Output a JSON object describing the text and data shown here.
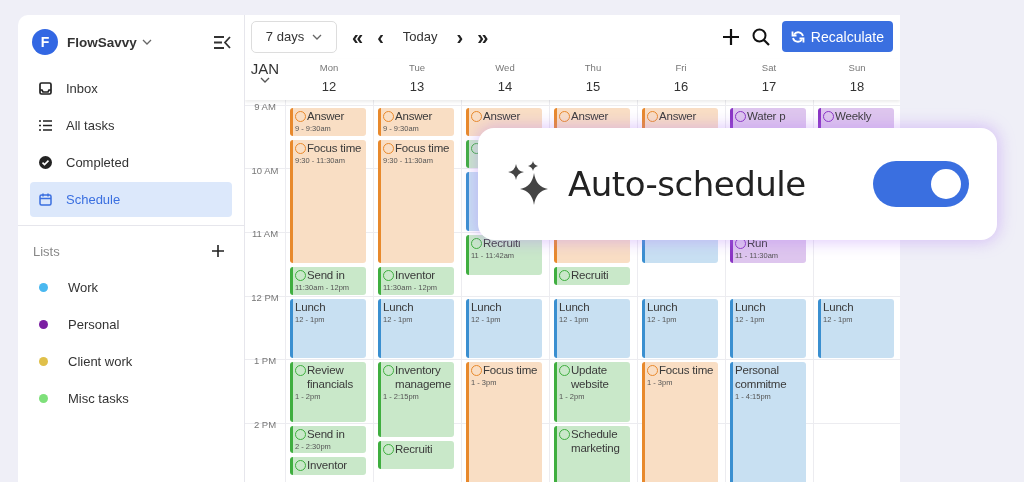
{
  "sidebar": {
    "workspace": {
      "initial": "F",
      "name": "FlowSavvy"
    },
    "nav": [
      {
        "label": "Inbox",
        "selected": false
      },
      {
        "label": "All tasks",
        "selected": false
      },
      {
        "label": "Completed",
        "selected": false
      },
      {
        "label": "Schedule",
        "selected": true
      }
    ],
    "lists_title": "Lists",
    "lists": [
      {
        "label": "Work",
        "color": "#4ab8f0"
      },
      {
        "label": "Personal",
        "color": "#7b1fa2"
      },
      {
        "label": "Client work",
        "color": "#e0c04a"
      },
      {
        "label": "Misc tasks",
        "color": "#7ee07a"
      }
    ]
  },
  "toolbar": {
    "range": "7 days",
    "first": "«",
    "prev": "‹",
    "today": "Today",
    "next": "›",
    "last": "»",
    "recalculate": "Recalculate"
  },
  "calendar": {
    "month": "JAN",
    "hours": [
      "9 AM",
      "10 AM",
      "11 AM",
      "12 PM",
      "1 PM",
      "2 PM"
    ],
    "days": [
      {
        "name": "Mon",
        "date": "12",
        "events": [
          {
            "kind": "task",
            "title": "Answer",
            "time": "9 - 9:30am",
            "color": "#e8892c"
          },
          {
            "kind": "task",
            "title": "Focus time",
            "time": "9:30 - 11:30am",
            "color": "#e8892c"
          },
          {
            "kind": "task",
            "title": "Send in",
            "time": "11:30am - 12pm",
            "color": "#3fae3f"
          },
          {
            "kind": "event",
            "title": "Lunch",
            "time": "12 - 1pm",
            "color": "#3a8fd0"
          },
          {
            "kind": "task",
            "title": "Review financials",
            "time": "1 - 2pm",
            "color": "#3fae3f"
          },
          {
            "kind": "task",
            "title": "Send in",
            "time": "2 - 2:30pm",
            "color": "#3fae3f"
          },
          {
            "kind": "task",
            "title": "Inventor",
            "color": "#3fae3f"
          }
        ]
      },
      {
        "name": "Tue",
        "date": "13",
        "events": [
          {
            "kind": "task",
            "title": "Answer",
            "time": "9 - 9:30am",
            "color": "#e8892c"
          },
          {
            "kind": "task",
            "title": "Focus time",
            "time": "9:30 - 11:30am",
            "color": "#e8892c"
          },
          {
            "kind": "task",
            "title": "Inventor",
            "time": "11:30am - 12pm",
            "color": "#3fae3f"
          },
          {
            "kind": "event",
            "title": "Lunch",
            "time": "12 - 1pm",
            "color": "#3a8fd0"
          },
          {
            "kind": "task",
            "title": "Inventory manageme",
            "time": "1 - 2:15pm",
            "color": "#3fae3f"
          },
          {
            "kind": "task",
            "title": "Recruiti",
            "color": "#3fae3f"
          }
        ]
      },
      {
        "name": "Wed",
        "date": "14",
        "events": [
          {
            "kind": "task",
            "title": "Answer",
            "color": "#e8892c"
          },
          {
            "kind": "task",
            "color": "#3fae3f"
          },
          {
            "kind": "event",
            "color": "#3a8fd0"
          },
          {
            "kind": "task",
            "title": "Recruiti",
            "time": "11 - 11:42am",
            "color": "#3fae3f"
          },
          {
            "kind": "event",
            "title": "Lunch",
            "time": "12 - 1pm",
            "color": "#3a8fd0"
          },
          {
            "kind": "task",
            "title": "Focus time",
            "time": "1 - 3pm",
            "color": "#e8892c"
          }
        ]
      },
      {
        "name": "Thu",
        "date": "15",
        "events": [
          {
            "kind": "task",
            "title": "Answer",
            "color": "#e8892c"
          },
          {
            "kind": "event",
            "color": "#e8892c"
          },
          {
            "kind": "task",
            "title": "Recruiti",
            "color": "#3fae3f"
          },
          {
            "kind": "event",
            "title": "Lunch",
            "time": "12 - 1pm",
            "color": "#3a8fd0"
          },
          {
            "kind": "task",
            "title": "Update website",
            "time": "1 - 2pm",
            "color": "#3fae3f"
          },
          {
            "kind": "task",
            "title": "Schedule marketing",
            "color": "#3fae3f"
          }
        ]
      },
      {
        "name": "Fri",
        "date": "16",
        "events": [
          {
            "kind": "task",
            "title": "Answer",
            "color": "#e8892c"
          },
          {
            "kind": "event",
            "color": "#3a8fd0"
          },
          {
            "kind": "event",
            "title": "Lunch",
            "time": "12 - 1pm",
            "color": "#3a8fd0"
          },
          {
            "kind": "task",
            "title": "Focus time",
            "time": "1 - 3pm",
            "color": "#e8892c"
          }
        ]
      },
      {
        "name": "Sat",
        "date": "17",
        "events": [
          {
            "kind": "task",
            "title": "Water p",
            "color": "#8a35c4"
          },
          {
            "kind": "task",
            "title": "Run",
            "time": "11 - 11:30am",
            "color": "#8a35c4"
          },
          {
            "kind": "event",
            "title": "Lunch",
            "time": "12 - 1pm",
            "color": "#3a8fd0"
          },
          {
            "kind": "event",
            "title": "Personal commitme",
            "time": "1 - 4:15pm",
            "color": "#3a8fd0"
          }
        ]
      },
      {
        "name": "Sun",
        "date": "18",
        "events": [
          {
            "kind": "task",
            "title": "Weekly",
            "color": "#8a35c4"
          },
          {
            "kind": "event",
            "title": "Lunch",
            "time": "12 - 1pm",
            "color": "#3a8fd0"
          }
        ]
      }
    ]
  },
  "popup": {
    "label": "Auto-schedule",
    "on": true
  }
}
